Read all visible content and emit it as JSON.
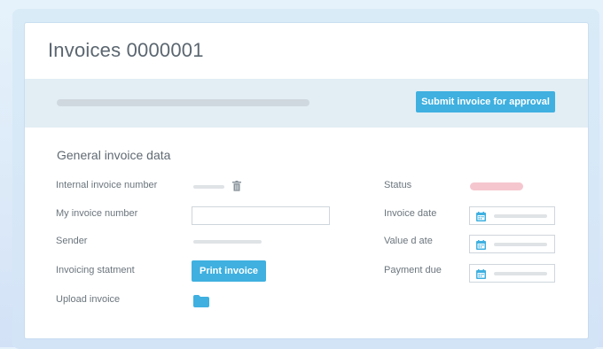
{
  "window": {
    "title": "Invoices 0000001"
  },
  "toolbar": {
    "submit_label": "Submit invoice for approval"
  },
  "section": {
    "title": "General invoice data",
    "labels": {
      "internal_invoice_number": "Internal invoice number",
      "my_invoice_number": "My invoice number",
      "sender": "Sender",
      "invoicing_statement": "Invoicing statment",
      "upload_invoice": "Upload invoice",
      "status": "Status",
      "invoice_date": "Invoice date",
      "value_date": "Value d ate",
      "payment_due": "Payment due"
    },
    "print_label": "Print invoice"
  },
  "colors": {
    "accent": "#3fb0e0",
    "band": "#e2eef4",
    "status": "#f6c6cf"
  },
  "icons": [
    "trash-icon",
    "calendar-icon",
    "folder-icon"
  ]
}
